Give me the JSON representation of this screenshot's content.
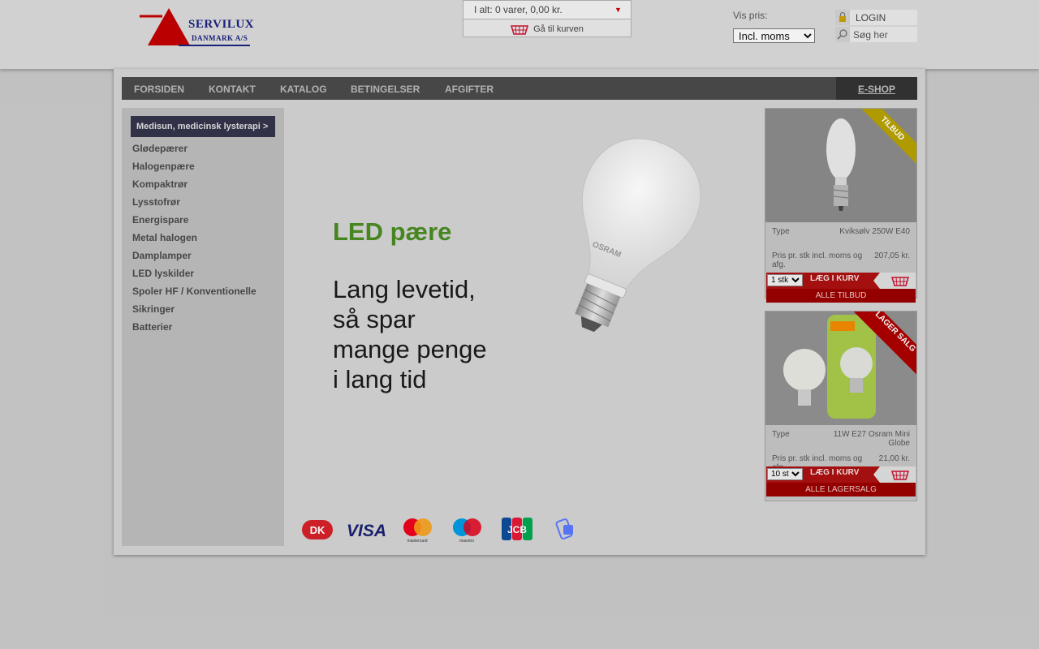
{
  "header": {
    "logo": {
      "line1": "SERVILUX",
      "line2": "DANMARK A/S"
    },
    "cart": {
      "summary": "I alt: 0 varer, 0,00 kr.",
      "goto_label": "Gå til kurven"
    },
    "price_display": {
      "label": "Vis pris:",
      "selected": "Incl. moms"
    },
    "login_label": "LOGIN",
    "search_placeholder": "Søg her"
  },
  "nav": {
    "items": [
      "FORSIDEN",
      "KONTAKT",
      "KATALOG",
      "BETINGELSER",
      "AFGIFTER"
    ],
    "eshop_label": "E-SHOP"
  },
  "sidebar": {
    "header": "Medisun, medicinsk lysterapi >",
    "items": [
      "Glødepærer",
      "Halogenpære",
      "Kompaktrør",
      "Lysstofrør",
      "Energispare",
      "Metal halogen",
      "Damplamper",
      "LED lyskilder",
      "Spoler HF / Konventionelle",
      "Sikringer",
      "Batterier"
    ]
  },
  "promo": {
    "title": "LED pære",
    "lines": [
      "Lang levetid,",
      "så spar",
      "mange penge",
      "i lang tid"
    ],
    "bulb_brand": "OSRAM"
  },
  "offers": [
    {
      "ribbon": "TILBUD",
      "type_label": "Type",
      "name": "Kviksølv 250W E40",
      "price_label": "Pris pr. stk incl. moms og afg.",
      "price": "207,05 kr.",
      "qty": "1 stk",
      "add_label": "LÆG I KURV",
      "all_label": "ALLE TILBUD"
    },
    {
      "ribbon": "LAGER SALG",
      "type_label": "Type",
      "name": "11W E27 Osram Mini Globe",
      "price_label": "Pris pr. stk incl. moms og afg.",
      "price": "21,00 kr.",
      "qty": "10 st",
      "add_label": "LÆG I KURV",
      "all_label": "ALLE LAGERSALG"
    }
  ],
  "payments": [
    "dankort-icon",
    "visa-icon",
    "mastercard-icon",
    "maestro-icon",
    "jcb-icon",
    "mobilepay-icon"
  ],
  "colors": {
    "nav_bg": "#4a4a4a",
    "promo_green": "#4a8a22",
    "offer_red": "#aa1010",
    "logo_red": "#c00000",
    "logo_blue": "#1a237e"
  }
}
